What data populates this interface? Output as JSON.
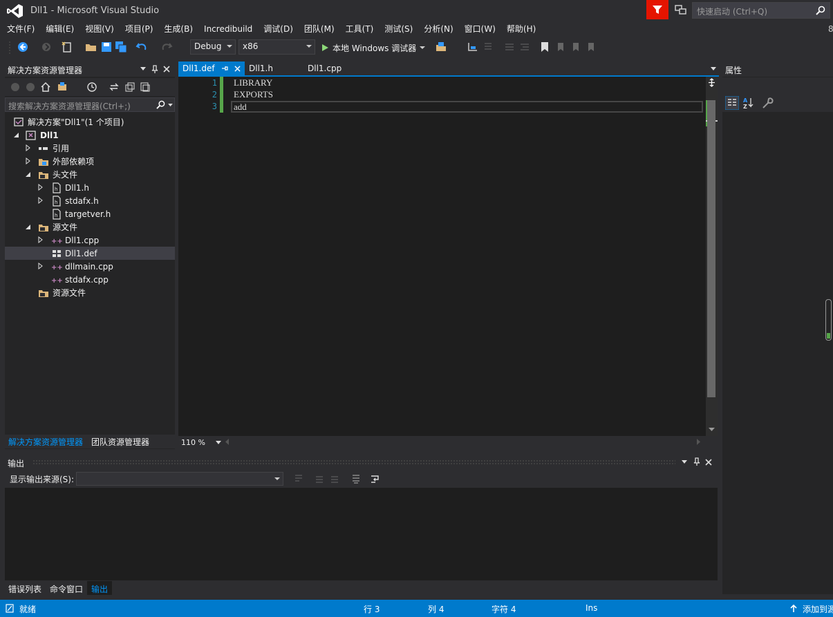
{
  "window": {
    "title": "Dll1 - Microsoft Visual Studio",
    "quick_launch_placeholder": "快速启动 (Ctrl+Q)"
  },
  "menu": [
    "文件(F)",
    "编辑(E)",
    "视图(V)",
    "项目(P)",
    "生成(B)",
    "Incredibuild",
    "调试(D)",
    "团队(M)",
    "工具(T)",
    "测试(S)",
    "分析(N)",
    "窗口(W)",
    "帮助(H)"
  ],
  "menu_extra": "8",
  "toolbar": {
    "config": "Debug",
    "platform": "x86",
    "run_label": "本地 Windows 调试器"
  },
  "solution_explorer": {
    "title": "解决方案资源管理器",
    "search_placeholder": "搜索解决方案资源管理器(Ctrl+;)",
    "solution": "解决方案\"Dll1\"(1 个项目)",
    "project": "Dll1",
    "nodes": {
      "references": "引用",
      "external": "外部依赖项",
      "headers": "头文件",
      "dll1_h": "Dll1.h",
      "stdafx_h": "stdafx.h",
      "targetver_h": "targetver.h",
      "sources": "源文件",
      "dll1_cpp": "Dll1.cpp",
      "dll1_def": "Dll1.def",
      "dllmain_cpp": "dllmain.cpp",
      "stdafx_cpp": "stdafx.cpp",
      "resources": "资源文件"
    },
    "tabs": [
      "解决方案资源管理器",
      "团队资源管理器"
    ]
  },
  "editor": {
    "tabs": [
      "Dll1.def",
      "Dll1.h",
      "Dll1.cpp"
    ],
    "line_numbers": [
      "1",
      "2",
      "3"
    ],
    "lines": [
      "LIBRARY",
      "EXPORTS",
      "add"
    ],
    "zoom": "110 %"
  },
  "properties": {
    "title": "属性"
  },
  "output": {
    "title": "输出",
    "source_label": "显示输出来源(S):",
    "tabs": [
      "错误列表",
      "命令窗口",
      "输出"
    ]
  },
  "status": {
    "ready": "就绪",
    "row": "行 3",
    "col": "列 4",
    "char": "字符 4",
    "ins": "Ins",
    "add_source": "添加到源"
  },
  "colors": {
    "accent": "#007acc",
    "notification": "#e51400",
    "change_bar": "#57a64a"
  }
}
